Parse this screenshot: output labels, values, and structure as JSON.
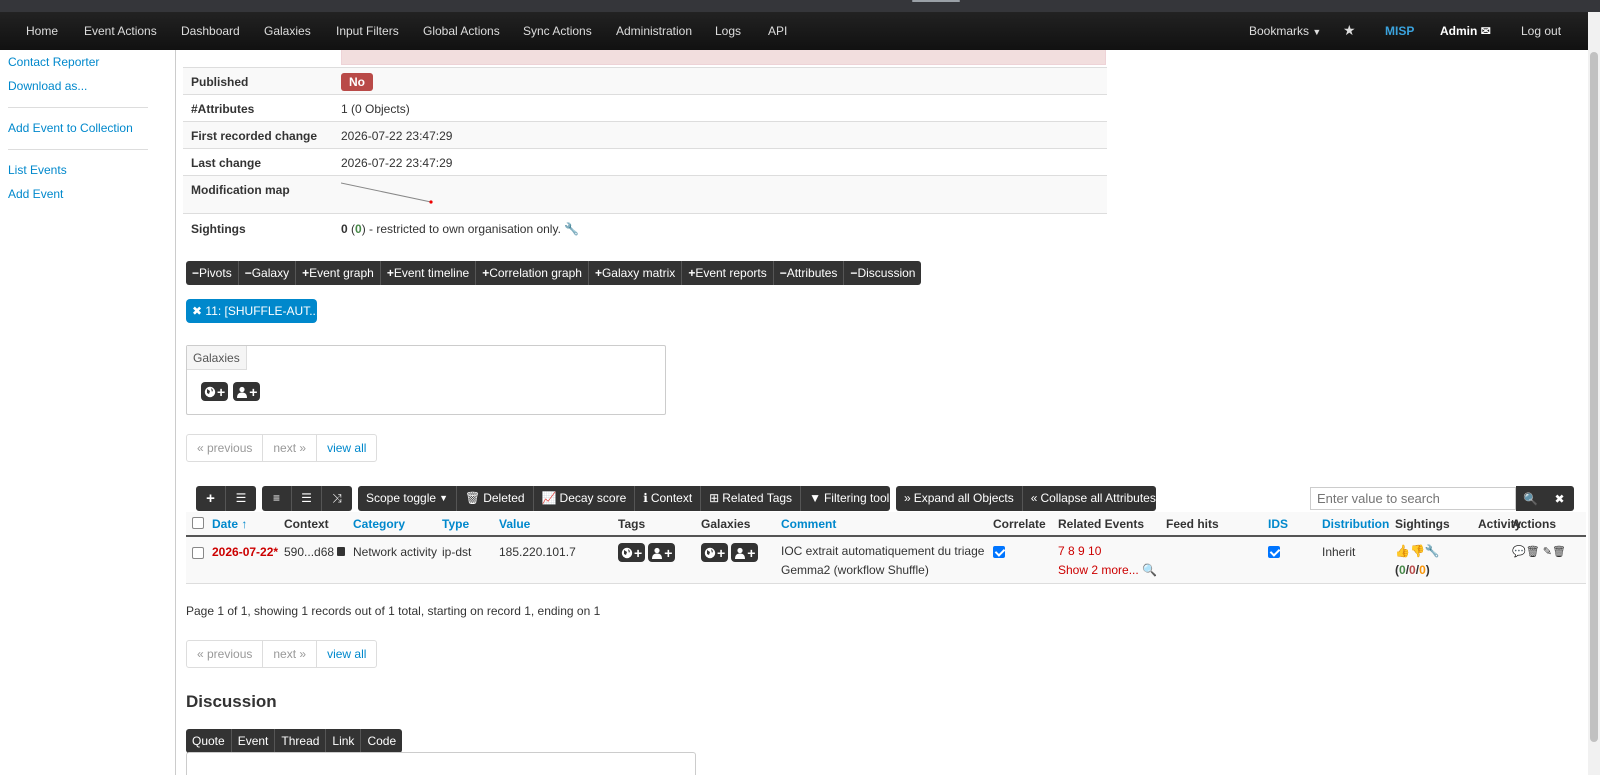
{
  "navbar": {
    "items": [
      "Home",
      "Event Actions",
      "Dashboard",
      "Galaxies",
      "Input Filters",
      "Global Actions",
      "Sync Actions",
      "Administration",
      "Logs",
      "API"
    ],
    "bookmarks": "Bookmarks",
    "brand": "MISP",
    "user": "Admin",
    "logout": "Log out"
  },
  "sidebar": {
    "contact_reporter": "Contact Reporter",
    "download_as": "Download as...",
    "add_to_collection": "Add Event to Collection",
    "list_events": "List Events",
    "add_event": "Add Event"
  },
  "meta": {
    "published_label": "Published",
    "published_value": "No",
    "attributes_label": "#Attributes",
    "attributes_value": "1 (0 Objects)",
    "first_change_label": "First recorded change",
    "first_change_value": "2026-07-22 23:47:29",
    "last_change_label": "Last change",
    "last_change_value": "2026-07-22 23:47:29",
    "modmap_label": "Modification map",
    "sightings_label": "Sightings",
    "sightings_count": "0",
    "sightings_paren_open": " (",
    "sightings_own": "0",
    "sightings_rest": ") - restricted to own organisation only."
  },
  "section_buttons": [
    "Pivots",
    "Galaxy",
    "Event graph",
    "Event timeline",
    "Correlation graph",
    "Galaxy matrix",
    "Event reports",
    "Attributes",
    "Discussion"
  ],
  "section_signs": [
    "−",
    "−",
    "+",
    "+",
    "+",
    "+",
    "+",
    "−",
    "−"
  ],
  "tag_chip": "11: [SHUFFLE-AUT...",
  "galaxies": {
    "header": "Galaxies"
  },
  "pager": {
    "previous": "« previous",
    "next": "next »",
    "view_all": "view all"
  },
  "toolbar": {
    "scope_toggle": "Scope toggle",
    "deleted": "Deleted",
    "decay_score": "Decay score",
    "context": "Context",
    "related_tags": "Related Tags",
    "filtering_tool": "Filtering tool",
    "expand_all": "Expand all Objects",
    "collapse_all": "Collapse all Attributes"
  },
  "search": {
    "placeholder": "Enter value to search"
  },
  "table": {
    "headers": {
      "date": "Date",
      "context": "Context",
      "category": "Category",
      "type": "Type",
      "value": "Value",
      "tags": "Tags",
      "galaxies": "Galaxies",
      "comment": "Comment",
      "correlate": "Correlate",
      "related_events": "Related Events",
      "feed_hits": "Feed hits",
      "ids": "IDS",
      "distribution": "Distribution",
      "sightings": "Sightings",
      "activity": "Activity",
      "actions": "Actions"
    },
    "row": {
      "date": "2026-07-22*",
      "context": "590...d68",
      "category": "Network activity",
      "type": "ip-dst",
      "value": "185.220.101.7",
      "comment_line1": "IOC extrait automatiquement du triage",
      "comment_line2": "Gemma2 (workflow Shuffle)",
      "related_events": "7 8 9 10",
      "show_more": "Show 2 more...",
      "distribution": "Inherit",
      "sight_open": "(",
      "sight_a": "0",
      "sight_sep1": "/",
      "sight_b": "0",
      "sight_sep2": "/",
      "sight_c": "0",
      "sight_close": ")"
    }
  },
  "page_info": "Page 1 of 1, showing 1 records out of 1 total, starting on record 1, ending on 1",
  "discussion": {
    "title": "Discussion",
    "buttons": [
      "Quote",
      "Event",
      "Thread",
      "Link",
      "Code"
    ]
  }
}
